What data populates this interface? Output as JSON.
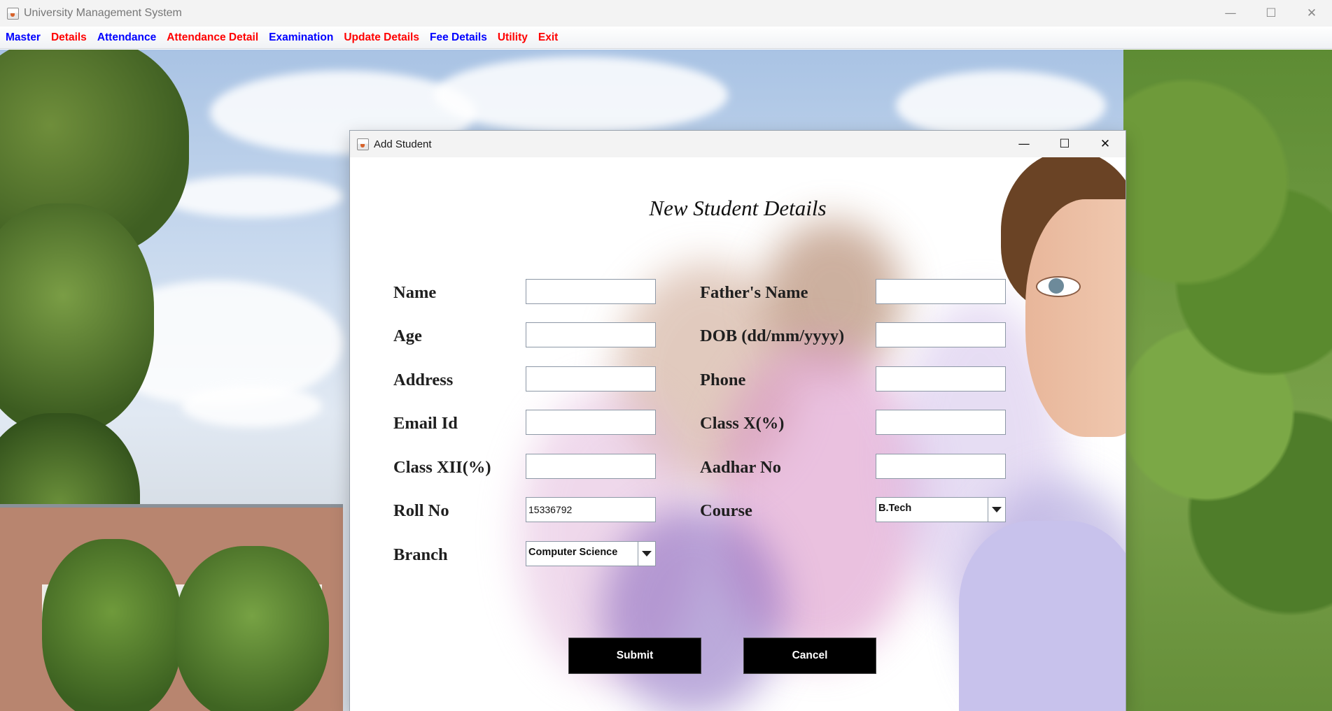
{
  "app": {
    "title": "University Management System",
    "controls": {
      "minimize": "—",
      "maximize": "☐",
      "close": "✕"
    }
  },
  "menu": [
    {
      "label": "Master",
      "color": "#0000ff"
    },
    {
      "label": "Details",
      "color": "#ff0000"
    },
    {
      "label": "Attendance",
      "color": "#0000ff"
    },
    {
      "label": "Attendance Detail",
      "color": "#ff0000"
    },
    {
      "label": "Examination",
      "color": "#0000ff"
    },
    {
      "label": "Update Details",
      "color": "#ff0000"
    },
    {
      "label": "Fee Details",
      "color": "#0000ff"
    },
    {
      "label": "Utility",
      "color": "#ff0000"
    },
    {
      "label": "Exit",
      "color": "#ff0000"
    }
  ],
  "dialog": {
    "title": "Add Student",
    "heading": "New Student Details",
    "controls": {
      "minimize": "—",
      "maximize": "☐",
      "close": "✕"
    },
    "fields": {
      "name": {
        "label": "Name",
        "value": ""
      },
      "fathers_name": {
        "label": "Father's Name",
        "value": ""
      },
      "age": {
        "label": "Age",
        "value": ""
      },
      "dob": {
        "label": "DOB (dd/mm/yyyy)",
        "value": ""
      },
      "address": {
        "label": "Address",
        "value": ""
      },
      "phone": {
        "label": "Phone",
        "value": ""
      },
      "email": {
        "label": "Email Id",
        "value": ""
      },
      "class_x": {
        "label": "Class X(%)",
        "value": ""
      },
      "class_xii": {
        "label": "Class XII(%)",
        "value": ""
      },
      "aadhar": {
        "label": "Aadhar No",
        "value": ""
      },
      "roll_no": {
        "label": "Roll No",
        "value": "15336792"
      },
      "course": {
        "label": "Course",
        "value": "B.Tech"
      },
      "branch": {
        "label": "Branch",
        "value": "Computer Science"
      }
    },
    "buttons": {
      "submit": "Submit",
      "cancel": "Cancel"
    }
  }
}
